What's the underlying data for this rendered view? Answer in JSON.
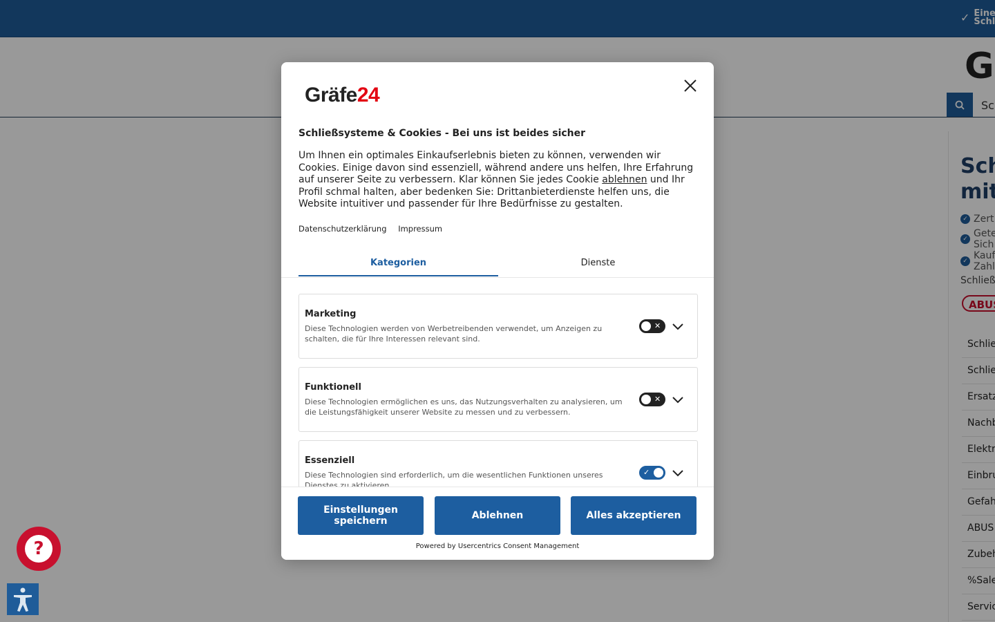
{
  "topbar": {
    "usp_line1": "Eine",
    "usp_line2": "Schl"
  },
  "header": {
    "logo_partial": "Gr",
    "search_icon": "search-icon",
    "search_placeholder": "Sc"
  },
  "sidebar": {
    "heading": "Sch\nmit",
    "usps": [
      "Zert",
      "Gete\nSich",
      "Kauf\nZahl"
    ],
    "brand_label": "Schließ",
    "brand_logo": "ABUS",
    "categories": [
      "Schlie",
      "Schlie",
      "Ersatz",
      "Nachb",
      "Elektr",
      "Einbru",
      "Gefah",
      "ABUS",
      "Zubeh",
      "%Sale",
      "Servic"
    ]
  },
  "consent": {
    "logo_part1": "Gräfe",
    "logo_part2": "24",
    "title": "Schließsysteme & Cookies - Bei uns ist beides sicher",
    "text_before_link": "Um Ihnen ein optimales Einkaufserlebnis bieten zu können, verwenden wir Cookies. Einige davon sind essenziell, während andere uns helfen, Ihre Erfahrung auf unserer Seite zu verbessern. Klar können Sie jedes Cookie ",
    "text_link": "ablehnen",
    "text_after_link": " und Ihr Profil schmal halten, aber bedenken Sie: Drittanbieterdienste helfen uns, die Website intuitiver und passender für Ihre Bedürfnisse zu gestalten.",
    "links": {
      "privacy": "Datenschutzerklärung",
      "imprint": "Impressum"
    },
    "tabs": {
      "categories": "Kategorien",
      "services": "Dienste"
    },
    "categories": [
      {
        "title": "Marketing",
        "description": "Diese Technologien werden von Werbetreibenden verwendet, um Anzeigen zu schalten, die für Ihre Interessen relevant sind.",
        "enabled": false
      },
      {
        "title": "Funktionell",
        "description": "Diese Technologien ermöglichen es uns, das Nutzungsverhalten zu analysieren, um die Leistungsfähigkeit unserer Website zu messen und zu verbessern.",
        "enabled": false
      },
      {
        "title": "Essenziell",
        "description": "Diese Technologien sind erforderlich, um die wesentlichen Funktionen unseres Dienstes zu aktivieren.",
        "enabled": true
      }
    ],
    "buttons": {
      "save": "Einstellungen speichern",
      "deny": "Ablehnen",
      "accept_all": "Alles akzeptieren"
    },
    "powered_by": "Powered by Usercentrics Consent Management"
  },
  "widgets": {
    "help_icon_text": "?"
  },
  "colors": {
    "brand_blue": "#1f5c99",
    "consent_blue": "#1d5ea0",
    "brand_red": "#e30613",
    "help_red": "#c8102e"
  }
}
